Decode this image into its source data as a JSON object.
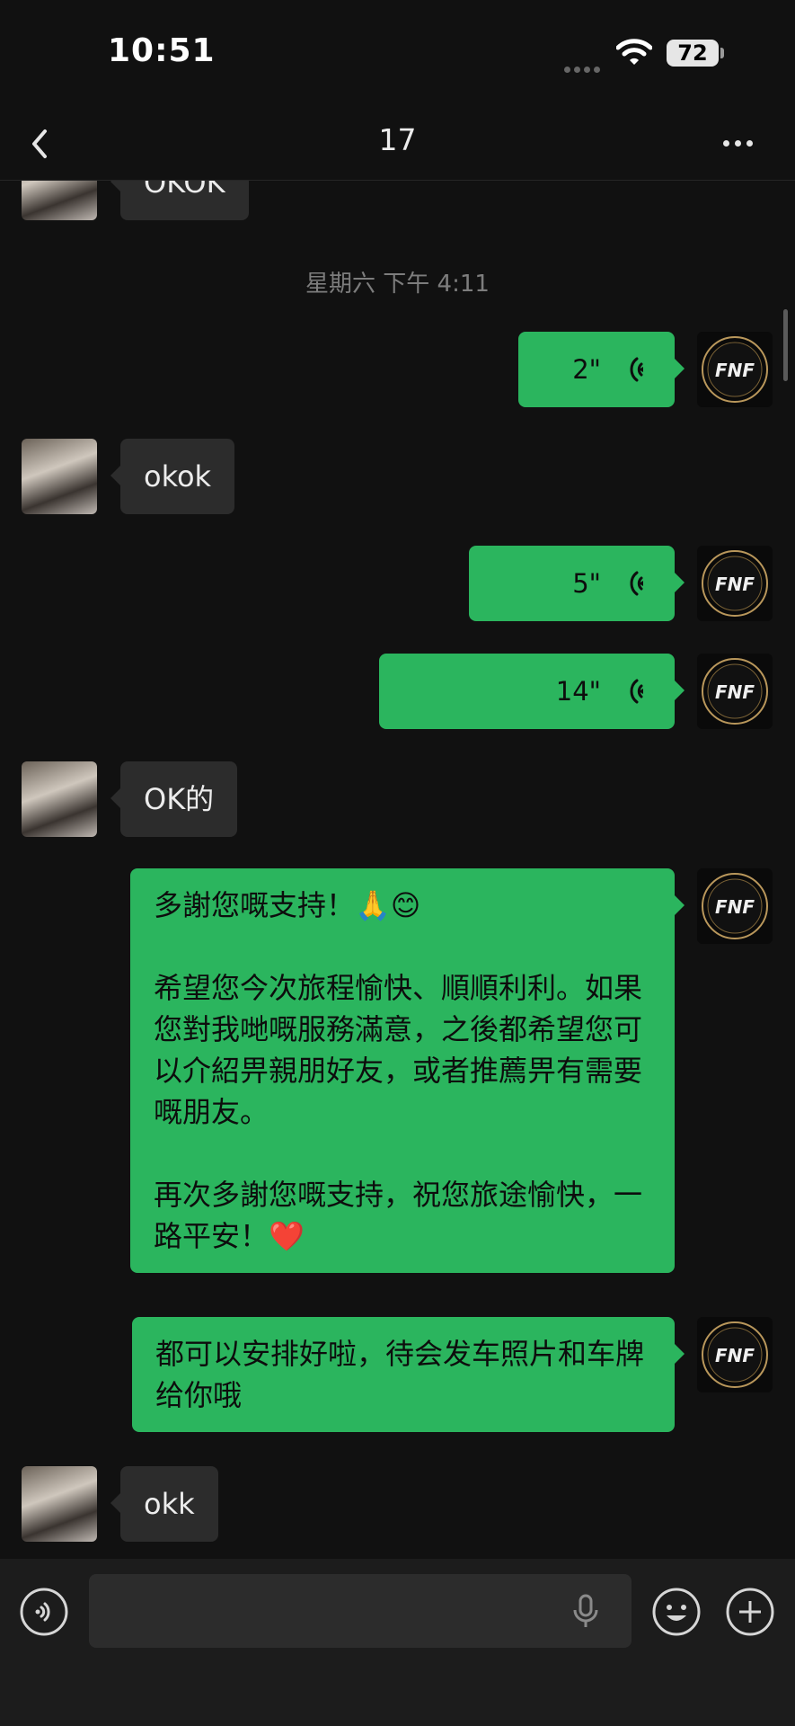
{
  "status": {
    "time": "10:51",
    "battery": "72"
  },
  "nav": {
    "title": "17"
  },
  "chat": {
    "partial_top": "OKOK",
    "timestamp": "星期六 下午 4:11",
    "voice1": "2\"",
    "msg_okok": "okok",
    "voice2": "5\"",
    "voice3": "14\"",
    "msg_okde": "OK的",
    "long_msg": {
      "p1": "多謝您嘅支持！🙏😊",
      "p2": "希望您今次旅程愉快、順順利利。如果您對我哋嘅服務滿意，之後都希望您可以介紹畀親朋好友，或者推薦畀有需要嘅朋友。",
      "p3": "再次多謝您嘅支持，祝您旅途愉快，一路平安！❤️"
    },
    "msg_arrange": "都可以安排好啦，待会发车照片和车牌给你哦",
    "msg_okk": "okk",
    "avatar_text": "FNF"
  },
  "colors": {
    "outgoing": "#2bb55e",
    "incoming": "#2c2c2c",
    "background": "#111111"
  },
  "icons": [
    "back-icon",
    "more-icon",
    "voice-wave-icon",
    "voice-input-icon",
    "mic-icon",
    "emoji-icon",
    "plus-icon",
    "wifi-icon",
    "battery-icon"
  ]
}
